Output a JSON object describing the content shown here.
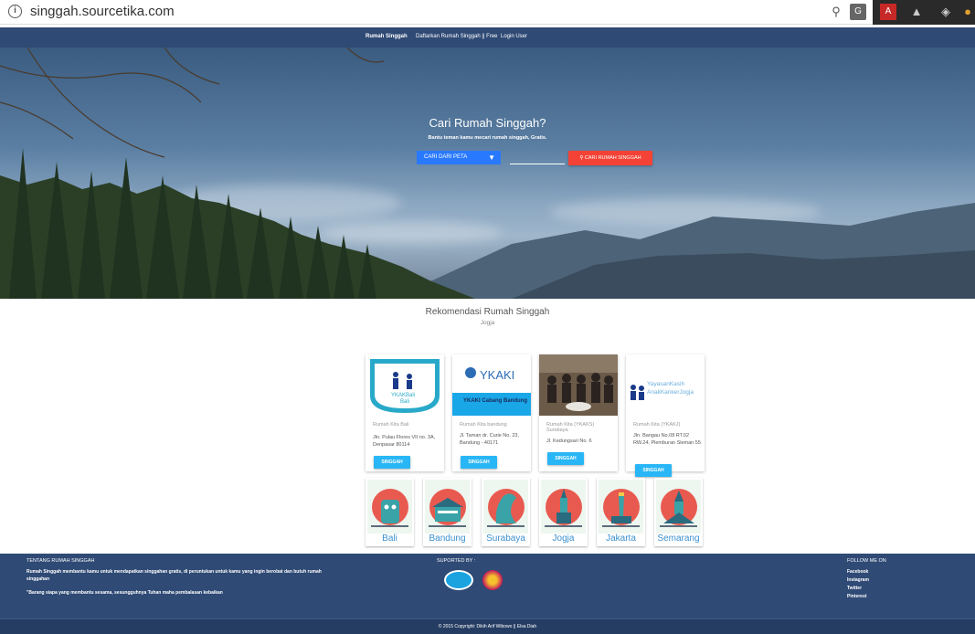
{
  "browser": {
    "url": "singgah.sourcetika.com"
  },
  "nav": {
    "items": [
      "Rumah Singgah",
      "Daftarkan Rumah Singgah || Free",
      "Login User"
    ]
  },
  "hero": {
    "title": "Cari Rumah Singgah?",
    "subtitle": "Bantu teman kamu mecari rumah singgah, Gratis.",
    "select_label": "CARI DARI PETA",
    "search_value": "",
    "search_button": "CARI RUMAH SINGGAH"
  },
  "recommendation": {
    "title": "Rekomendasi Rumah Singgah",
    "subtitle": "Jogja",
    "cards": [
      {
        "title": "Rumah Kita Bali",
        "address": "Jln. Pulau Flores VII no. 3A, Denpasar 80114",
        "button": "SINGGAH",
        "image_label": "YKAKBali"
      },
      {
        "title": "Rumah Kita bandung",
        "address": "Jl. Taman dr. Curie No. 23, Bandung - 40171",
        "button": "SINGGAH",
        "image_label": "YKAKI",
        "image_sub": "YKAKI Cabang Bandung"
      },
      {
        "title": "Rumah Kita (YKAKS) Surabaya",
        "address": "Jl. Kedungsari No. 6",
        "button": "SINGGAH"
      },
      {
        "title": "Rumah Kita (YKAKJ)",
        "address": "Jln. Bangau No.08 RT.02 RW.24, Plemburan Sleman 55",
        "button": "SINGGAH",
        "image_label": "YayasanKasih AnakKankerJogja"
      }
    ],
    "cities": [
      "Bali",
      "Bandung",
      "Surabaya",
      "Jogja",
      "Jakarta",
      "Semarang"
    ]
  },
  "footer": {
    "about_title": "TENTANG RUMAH SINGGAH",
    "about_text_1": "Rumah Singgah membantu kamu untuk mendapatkan singgahan gratis, di peruntukan untuk kamu yang ingin berobat dan butuh rumah singgahan",
    "about_text_2": "\"Barang siapa yang membantu sesama, sesungguhnya Tuhan maha pembalasan kebaikan",
    "supported_title": "SUPORTED BY :",
    "follow_title": "FOLLOW ME ON",
    "social": [
      "Facebook",
      "Instagram",
      "Twitter",
      "Pinterest"
    ],
    "copyright": "© 2015 Copyright: Dikih Arif Wibowo || Elsa Diah"
  },
  "colors": {
    "nav": "#2f4a75",
    "primary": "#2979ff",
    "danger": "#f44336",
    "accent": "#29b6f6"
  }
}
